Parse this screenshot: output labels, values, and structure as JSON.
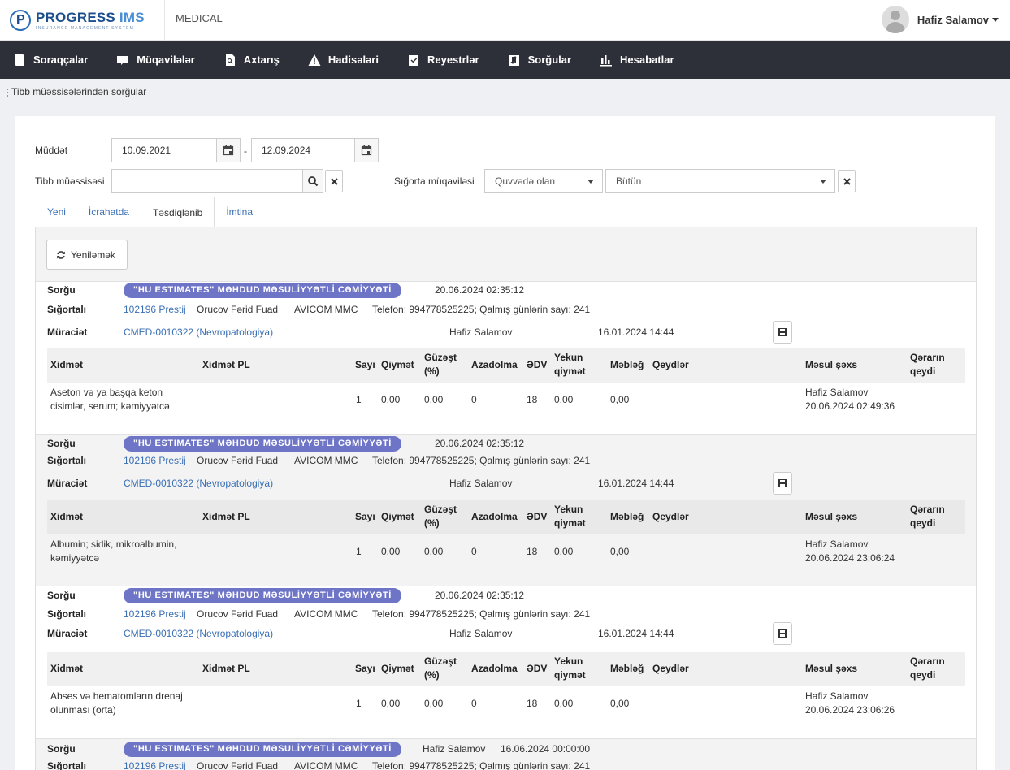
{
  "header": {
    "logo_name": "PROGRESS",
    "logo_ims": "IMS",
    "logo_sub": "INSURANCE MANAGEMENT SYSTEM",
    "app_name": "MEDICAL",
    "user_name": "Hafiz Salamov"
  },
  "nav": [
    {
      "label": "Soraqçalar",
      "icon": "book-icon"
    },
    {
      "label": "Müqavilələr",
      "icon": "contract-icon"
    },
    {
      "label": "Axtarış",
      "icon": "search-doc-icon"
    },
    {
      "label": "Hadisələri",
      "icon": "warning-icon"
    },
    {
      "label": "Reyestrlər",
      "icon": "checklist-icon"
    },
    {
      "label": "Sorğular",
      "icon": "transfer-icon"
    },
    {
      "label": "Hesabatlar",
      "icon": "bar-chart-icon"
    }
  ],
  "breadcrumb": "Tibb müəssisələrindən sorğular",
  "filters": {
    "period_label": "Müddət",
    "date_from": "10.09.2021",
    "date_to": "12.09.2024",
    "date_sep": "-",
    "medical_label": "Tibb müəssisəsi",
    "medical_value": "",
    "contract_label": "Sığorta müqaviləsi",
    "contract_status": "Quvvədə olan",
    "contract_value": "Bütün"
  },
  "tabs": [
    "Yeni",
    "İcrahatda",
    "Təsdiqlənib",
    "İmtina"
  ],
  "refresh_label": "Yeniləmək",
  "labels": {
    "request": "Sorğu",
    "insured": "Sığortalı",
    "appeal": "Müraciət"
  },
  "columns": {
    "service": "Xidmət",
    "service_pl": "Xidmət PL",
    "count": "Sayı",
    "price": "Qiymət",
    "discount": "Güzəşt (%)",
    "exemption": "Azadolma",
    "vat": "ƏDV",
    "total": "Yekun qiymət",
    "amount": "Məbləğ",
    "notes": "Qeydlər",
    "responsible": "Məsul şəxs",
    "decision": "Qərarın qeydi"
  },
  "records": [
    {
      "company": "\"HU ESTIMATES\" MƏHDUD MƏSULİYYƏTLİ CƏMİYYƏTİ",
      "request_date": "20.06.2024 02:35:12",
      "policy": "102196 Prestij",
      "insured_name": "Orucov Fərid Fuad",
      "insurer": "AVICOM MMC",
      "phone_info": "Telefon: 994778525225; Qalmış günlərin sayı: 241",
      "appeal_code": "CMED-0010322 (Nevropatologiya)",
      "appeal_person": "Hafiz Salamov",
      "appeal_date": "16.01.2024 14:44",
      "service": "Aseton və ya başqa keton cisimlər, serum; kəmiyyətcə",
      "count": "1",
      "price": "0,00",
      "discount": "0,00",
      "exemption": "0",
      "vat": "18",
      "total": "0,00",
      "amount": "0,00",
      "responsible": "Hafiz Salamov",
      "responsible_date": "20.06.2024 02:49:36"
    },
    {
      "company": "\"HU ESTIMATES\" MƏHDUD MƏSULİYYƏTLİ CƏMİYYƏTİ",
      "request_date": "20.06.2024 02:35:12",
      "policy": "102196 Prestij",
      "insured_name": "Orucov Fərid Fuad",
      "insurer": "AVICOM MMC",
      "phone_info": "Telefon: 994778525225; Qalmış günlərin sayı: 241",
      "appeal_code": "CMED-0010322 (Nevropatologiya)",
      "appeal_person": "Hafiz Salamov",
      "appeal_date": "16.01.2024 14:44",
      "service": "Albumin; sidik, mikroalbumin, kəmiyyətcə",
      "count": "1",
      "price": "0,00",
      "discount": "0,00",
      "exemption": "0",
      "vat": "18",
      "total": "0,00",
      "amount": "0,00",
      "responsible": "Hafiz Salamov",
      "responsible_date": "20.06.2024 23:06:24"
    },
    {
      "company": "\"HU ESTIMATES\" MƏHDUD MƏSULİYYƏTLİ CƏMİYYƏTİ",
      "request_date": "20.06.2024 02:35:12",
      "policy": "102196 Prestij",
      "insured_name": "Orucov Fərid Fuad",
      "insurer": "AVICOM MMC",
      "phone_info": "Telefon: 994778525225; Qalmış günlərin sayı: 241",
      "appeal_code": "CMED-0010322 (Nevropatologiya)",
      "appeal_person": "Hafiz Salamov",
      "appeal_date": "16.01.2024 14:44",
      "service": "Abses və hematomların drenaj olunması (orta)",
      "count": "1",
      "price": "0,00",
      "discount": "0,00",
      "exemption": "0",
      "vat": "18",
      "total": "0,00",
      "amount": "0,00",
      "responsible": "Hafiz Salamov",
      "responsible_date": "20.06.2024 23:06:26"
    },
    {
      "company": "\"HU ESTIMATES\" MƏHDUD MƏSULİYYƏTLİ CƏMİYYƏTİ",
      "request_person": "Hafiz Salamov",
      "request_date": "16.06.2024 00:00:00",
      "policy": "102196 Prestij",
      "insured_name": "Orucov Fərid Fuad",
      "insurer": "AVICOM MMC",
      "phone_info": "Telefon: 994778525225; Qalmış günlərin sayı: 241"
    }
  ]
}
